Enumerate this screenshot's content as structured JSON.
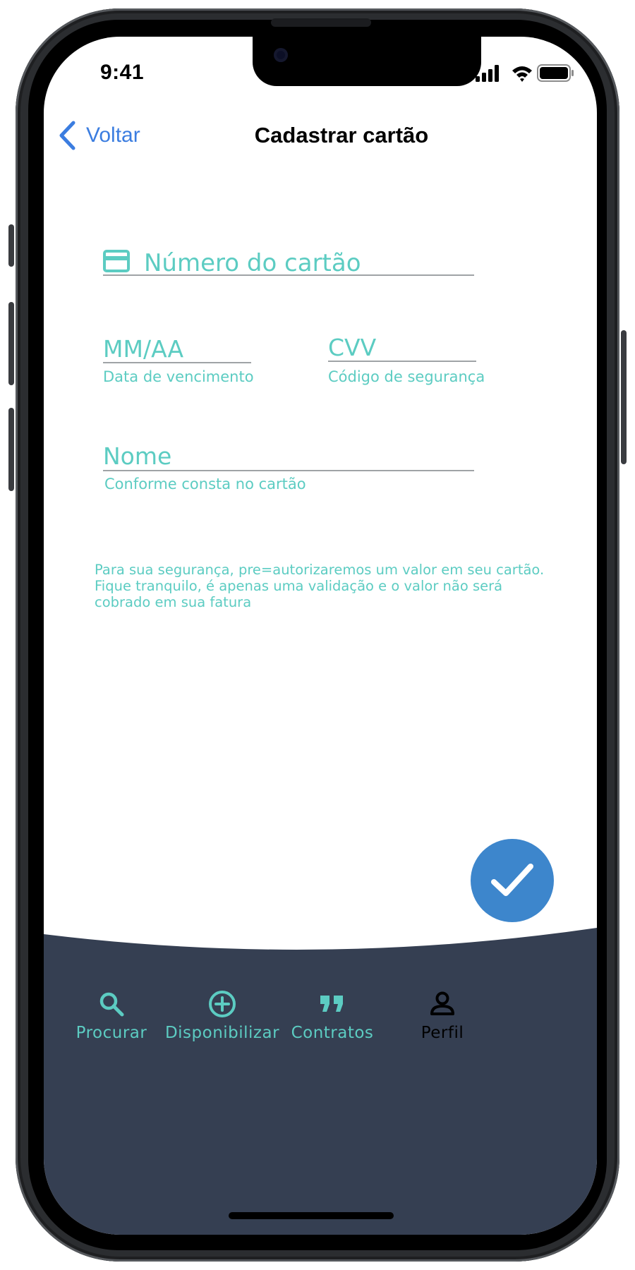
{
  "status_bar": {
    "time": "9:41"
  },
  "nav": {
    "back_label": "Voltar",
    "title": "Cadastrar cartão"
  },
  "form": {
    "card_number": {
      "placeholder": "Número do cartão",
      "value": "",
      "icon": "credit-card-icon"
    },
    "expiry": {
      "placeholder": "MM/AA",
      "value": "",
      "helper": "Data de vencimento"
    },
    "cvv": {
      "placeholder": "CVV",
      "value": "",
      "helper": "Código de segurança"
    },
    "name": {
      "placeholder": "Nome",
      "value": "",
      "helper": "Conforme consta no cartão"
    }
  },
  "notice": {
    "line1": "Para sua segurança, pre=autorizaremos um valor em seu cartão.",
    "line2": "Fique tranquilo, é apenas uma validação e o valor não será",
    "line3": "cobrado em sua fatura"
  },
  "fab": {
    "icon": "checkmark-icon"
  },
  "tabs": [
    {
      "label": "Procurar",
      "icon": "search-icon",
      "active": false
    },
    {
      "label": "Disponibilizar",
      "icon": "plus-circle-icon",
      "active": false
    },
    {
      "label": "Contratos",
      "icon": "quote-icon",
      "active": false
    },
    {
      "label": "Perfil",
      "icon": "person-icon",
      "active": true
    }
  ],
  "colors": {
    "accent_teal": "#5cccc2",
    "link_blue": "#3b7de0",
    "fab_blue": "#3d86cc",
    "tabbar_bg": "#353f52"
  }
}
